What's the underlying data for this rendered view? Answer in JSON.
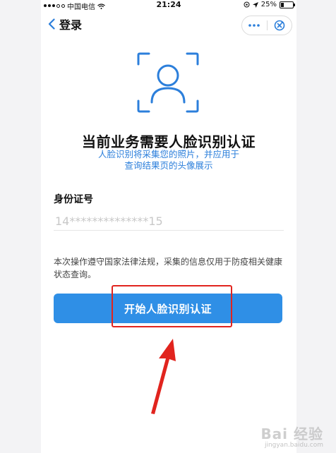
{
  "status_bar": {
    "carrier": "中国电信",
    "time": "21:24",
    "battery": "25%",
    "battery_level": 0.25
  },
  "nav": {
    "back_label": "登录",
    "icons": [
      "chevron-left-icon",
      "more-dots-icon",
      "close-circle-icon"
    ]
  },
  "main": {
    "title": "当前业务需要人脸识别认证",
    "subtitle_line1": "人脸识别将采集您的照片，并应用于",
    "subtitle_line2": "查询结果页的头像展示",
    "id_label": "身份证号",
    "id_value": "14**************15",
    "notice": "本次操作遵守国家法律法规，采集的信息仅用于防疫相关健康状态查询。",
    "start_button": "开始人脸识别认证"
  },
  "watermark": {
    "main": "Bai 经验",
    "sub": "jingyan.baidu.com"
  },
  "colors": {
    "accent": "#2f8fe6",
    "subtitle": "#2c7fdb",
    "highlight": "#e1241e"
  }
}
